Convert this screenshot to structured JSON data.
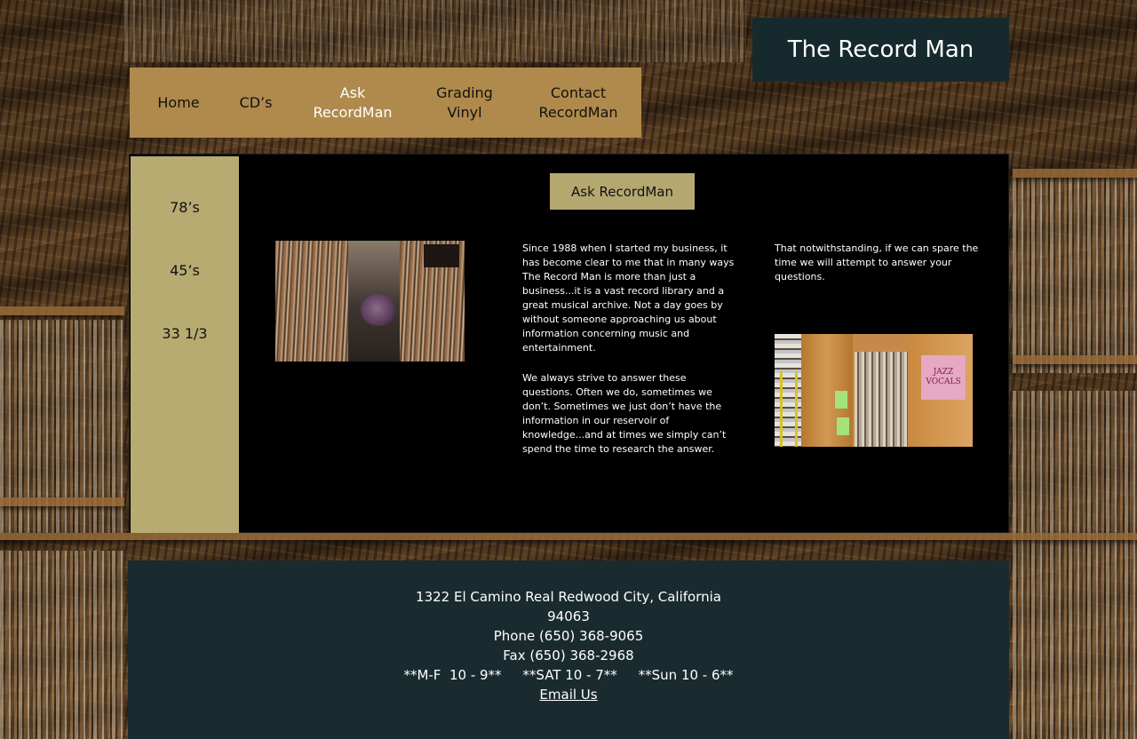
{
  "site": {
    "title": "The Record Man"
  },
  "nav": {
    "items": [
      {
        "label": "Home"
      },
      {
        "label": "CD’s"
      },
      {
        "label": "Ask RecordMan"
      },
      {
        "label": "Grading Vinyl"
      },
      {
        "label": "Contact RecordMan"
      }
    ]
  },
  "sidebar": {
    "items": [
      {
        "label": "78’s"
      },
      {
        "label": "45’s"
      },
      {
        "label": "33 1/3"
      }
    ]
  },
  "main": {
    "heading": "Ask RecordMan",
    "column1": [
      "Since 1988 when I started my business, it has become clear to me that in many ways The Record Man is more than just a business...it is a vast record library and a great musical archive.  Not a day goes by without someone approaching us about information concerning music and entertainment.",
      "We always strive to answer these questions.  Often we do, sometimes we don’t.  Sometimes we just don’t have the information in our reservoir of knowledge...and at times we simply can’t spend the time to research the answer."
    ],
    "column2": "That notwithstanding, if we can spare the time we will attempt to answer your questions.",
    "photo_sign": "JAZZ VOCALS"
  },
  "footer": {
    "address": "1322 El Camino Real Redwood City, California 94063",
    "phone": "Phone (650) 368-9065",
    "fax": "Fax (650) 368-2968",
    "hours": "**M-F  10 - 9**     **SAT 10 - 7**     **Sun 10 - 6**",
    "email_label": "Email Us"
  }
}
